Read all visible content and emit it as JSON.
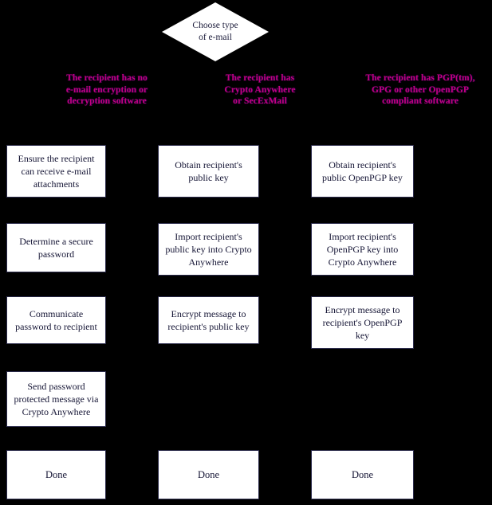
{
  "diagram": {
    "title": "Choose type of e-mail",
    "background_color": "#000000",
    "box_fill_color": "#ffffff",
    "box_text_color": "#151535",
    "header_text_color": "#c2007f"
  },
  "decision": {
    "label": "Choose type\nof e-mail",
    "shape": "diamond"
  },
  "branches": [
    {
      "header": "The recipient has no\ne-mail encryption or\ndecryption software",
      "steps": [
        "Ensure the recipient\ncan receive e-mail\nattachments",
        "Determine a secure\npassword",
        "Communicate\npassword to recipient",
        "Send password\nprotected message via\nCrypto Anywhere"
      ],
      "end": "Done"
    },
    {
      "header": "The recipient has\nCrypto Anywhere\nor SecExMail",
      "steps": [
        "Obtain recipient's\npublic key",
        "Import recipient's\npublic key into Crypto\nAnywhere",
        "Encrypt message to\nrecipient's public key"
      ],
      "end": "Done"
    },
    {
      "header": "The recipient has PGP(tm),\nGPG or other OpenPGP\ncompliant software",
      "steps": [
        "Obtain recipient's\npublic OpenPGP key",
        "Import recipient's\nOpenPGP key into\nCrypto Anywhere",
        "Encrypt message to\nrecipient's OpenPGP\nkey"
      ],
      "end": "Done"
    }
  ]
}
